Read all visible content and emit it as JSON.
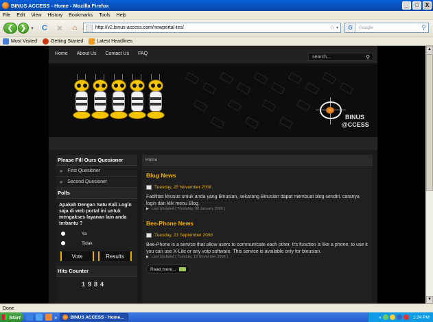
{
  "window": {
    "title": "BINUS ACCESS - Home - Mozilla Firefox",
    "buttons": [
      "_",
      "□",
      "X"
    ]
  },
  "menu": [
    "File",
    "Edit",
    "View",
    "History",
    "Bookmarks",
    "Tools",
    "Help"
  ],
  "toolbar": {
    "back_glyph": "❮",
    "forward_glyph": "❯",
    "reload_glyph": "C",
    "stop_glyph": "✕",
    "home_glyph": "⌂",
    "url": "http://v2.binus-access.com/newportal-tes/",
    "search_placeholder": "Google",
    "search_engine_glyph": "G"
  },
  "bookmarks": [
    {
      "label": "Most Visited",
      "icon": "bookmark-icon",
      "color": "#4a7fd6"
    },
    {
      "label": "Getting Started",
      "icon": "firefox-icon",
      "color": "#c8380c"
    },
    {
      "label": "Latest Headlines",
      "icon": "rss-icon",
      "color": "#f09a20"
    }
  ],
  "site": {
    "nav": [
      "Home",
      "About Us",
      "Contact Us",
      "FAQ"
    ],
    "search_placeholder": "search...",
    "logo_line1": "BINUS",
    "logo_line2": "@CCESS",
    "breadcrumb": "Home",
    "sidebar": {
      "questioner_title": "Please Fill Ours Quesioner",
      "questioner_items": [
        "First Quesioner",
        "Second Quesioner"
      ],
      "polls_title": "Polls",
      "poll_question": "Apakah Dengan Satu Kali Login saja di web portal ini untuk mengakses layanan lain anda terbantu ?",
      "poll_options": [
        "Ya",
        "Tidak"
      ],
      "vote_label": "Vote",
      "results_label": "Results",
      "hits_title": "Hits Counter",
      "hits_value": "1984"
    },
    "articles": [
      {
        "section": "Blog News",
        "date": "Tuesday, 25 November 2008",
        "text": "Fasilitas khusus untuk anda yang Binusian, sekarang Binusian dapat membuat blog sendiri. caranya login dan klik menu Blog.",
        "updated": "Last Updated ( Thursday, 08 January 2009 )"
      },
      {
        "section": "Bee-Phone News",
        "date": "Tuesday, 23 September 2008",
        "text": "Bee-Phone is a service that allow users to communicate each other. It's function is like a phone, to use it you can use X-Lite or any voip software. This service is available only for binusian.",
        "updated": "Last Updated ( Tuesday, 18 November 2008 )"
      }
    ],
    "read_more": "Read more..."
  },
  "status": "Done",
  "taskbar": {
    "start": "Start",
    "more_glyph": "»",
    "task": "BINUS ACCESS - Home...",
    "time": "1:24 PM",
    "tray_more": "«"
  },
  "colors": {
    "accent": "#f0b000",
    "site_bg": "#1a1a1a",
    "xp_blue": "#0a5fd8"
  }
}
